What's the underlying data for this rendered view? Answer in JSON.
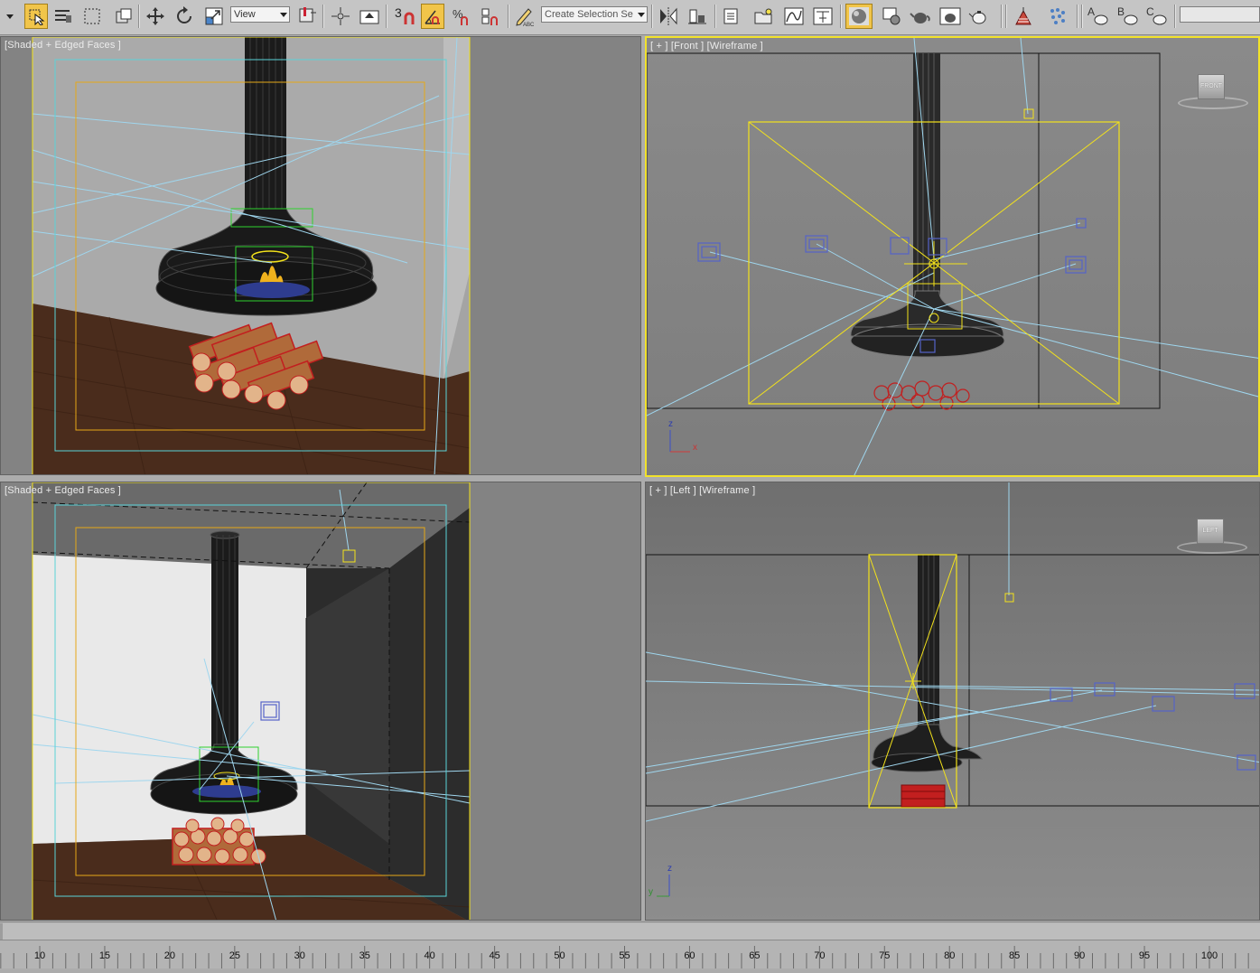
{
  "toolbar": {
    "view_dropdown": "View",
    "snap_number": "3",
    "selection_set": "Create Selection Se",
    "render_letters": [
      "A",
      "B",
      "C"
    ]
  },
  "viewports": {
    "top_left": {
      "label": "[Shaded + Edged Faces ]"
    },
    "top_right": {
      "label": "[ + ] [Front ] [Wireframe ]",
      "cube": "FRONT"
    },
    "bottom_left": {
      "label": "[Shaded + Edged Faces ]"
    },
    "bottom_right": {
      "label": "[ + ] [Left ] [Wireframe ]",
      "cube": "LEFT"
    }
  },
  "axis": {
    "x": "x",
    "y": "y",
    "z": "z"
  },
  "timeline": {
    "ticks": [
      "10",
      "15",
      "20",
      "25",
      "30",
      "35",
      "40",
      "45",
      "50",
      "55",
      "60",
      "65",
      "70",
      "75",
      "80",
      "85",
      "90",
      "95",
      "100"
    ]
  },
  "colors": {
    "selection": "#f3e21b",
    "safe_frame_outer": "#5ad3d8",
    "safe_frame_inner": "#e6a817",
    "light_lines": "#9fd6ee",
    "gizmo_blue": "#5563c8"
  }
}
